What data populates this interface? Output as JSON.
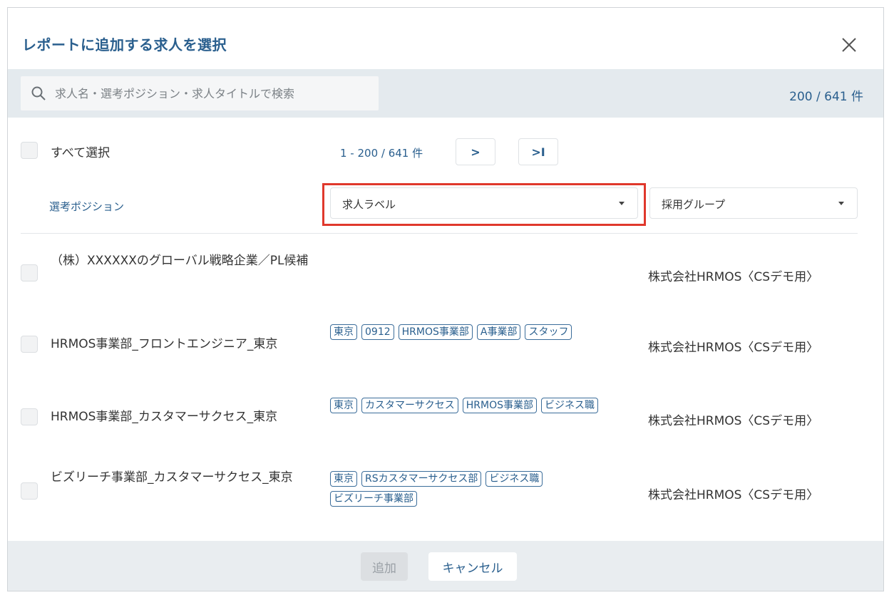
{
  "modal": {
    "title": "レポートに追加する求人を選択"
  },
  "search": {
    "placeholder": "求人名・選考ポジション・求人タイトルで検索",
    "value": "",
    "count": "200 / 641 件"
  },
  "list_header": {
    "select_all_label": "すべて選択",
    "pager_text": "1 - 200 / 641 件",
    "next_label": ">",
    "last_label": ">I",
    "column_position": "選考ポジション",
    "filter_label": "求人ラベル",
    "filter_group": "採用グループ"
  },
  "rows": [
    {
      "name": "（株）XXXXXXのグローバル戦略企業／PL候補",
      "tags": [],
      "company": "株式会社HRMOS〈CSデモ用〉"
    },
    {
      "name": "HRMOS事業部_フロントエンジニア_東京",
      "tags": [
        "東京",
        "0912",
        "HRMOS事業部",
        "A事業部",
        "スタッフ"
      ],
      "company": "株式会社HRMOS〈CSデモ用〉"
    },
    {
      "name": "HRMOS事業部_カスタマーサクセス_東京",
      "tags": [
        "東京",
        "カスタマーサクセス",
        "HRMOS事業部",
        "ビジネス職"
      ],
      "company": "株式会社HRMOS〈CSデモ用〉"
    },
    {
      "name": "ビズリーチ事業部_カスタマーサクセス_東京",
      "tags": [
        "東京",
        "RSカスタマーサクセス部",
        "ビジネス職",
        "ビズリーチ事業部"
      ],
      "company": "株式会社HRMOS〈CSデモ用〉"
    }
  ],
  "footer": {
    "add_label": "追加",
    "cancel_label": "キャンセル"
  },
  "colors": {
    "accent": "#2a5f8e",
    "highlight": "#e0382c",
    "search_band": "#e4eaee",
    "footer_band": "#e9edf0"
  }
}
